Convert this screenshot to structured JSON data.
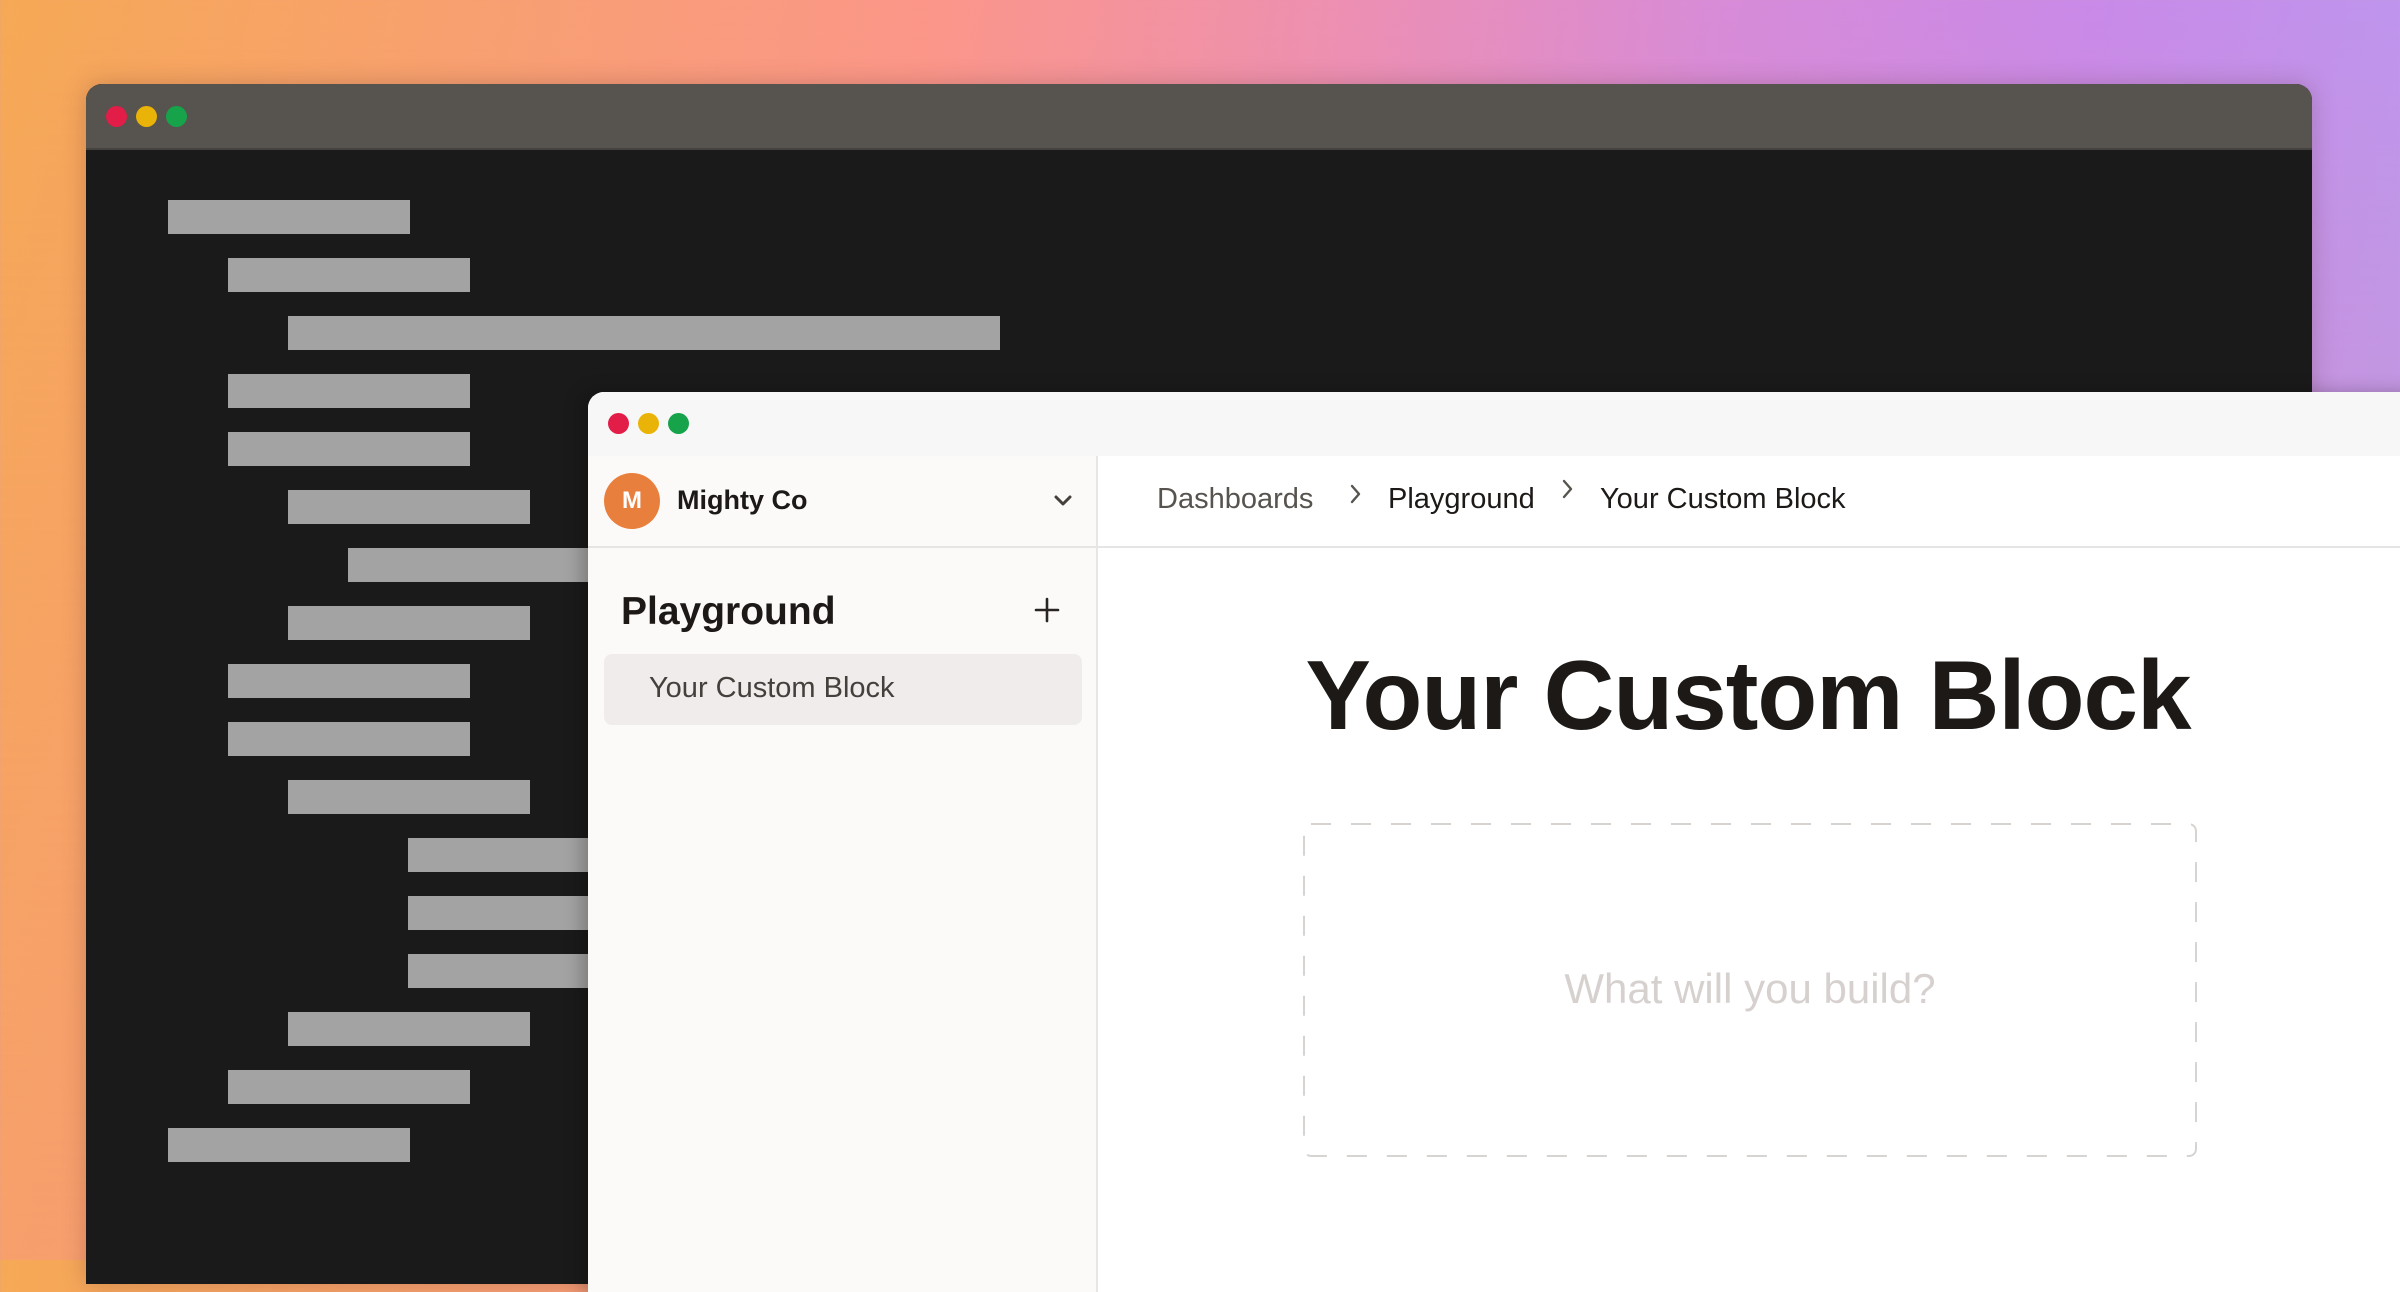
{
  "background": {
    "gradient_colors": [
      "#f6a955",
      "#fb968a",
      "#c98ae8",
      "#b79cf0"
    ]
  },
  "code_window": {
    "traffic_lights": [
      {
        "name": "close",
        "color": "#e11d48"
      },
      {
        "name": "minimize",
        "color": "#eab308"
      },
      {
        "name": "maximize",
        "color": "#16a34a"
      }
    ],
    "titlebar_color": "#57534f",
    "body_color": "#1a1a1a",
    "placeholder_line_color": "#a3a3a3",
    "code_lines": [
      {
        "indent": 0,
        "size": "short"
      },
      {
        "indent": 1,
        "size": "short"
      },
      {
        "indent": 2,
        "size": "long"
      },
      {
        "indent": 1,
        "size": "short"
      },
      {
        "indent": 1,
        "size": "short"
      },
      {
        "indent": 2,
        "size": "short"
      },
      {
        "indent": 3,
        "size": "short"
      },
      {
        "indent": 2,
        "size": "short"
      },
      {
        "indent": 1,
        "size": "short"
      },
      {
        "indent": 1,
        "size": "short"
      },
      {
        "indent": 2,
        "size": "short"
      },
      {
        "indent": 4,
        "size": "short"
      },
      {
        "indent": 4,
        "size": "short"
      },
      {
        "indent": 4,
        "size": "short"
      },
      {
        "indent": 2,
        "size": "short"
      },
      {
        "indent": 1,
        "size": "short"
      },
      {
        "indent": 0,
        "size": "short"
      }
    ]
  },
  "app_window": {
    "traffic_lights": [
      {
        "name": "close",
        "color": "#e11d48"
      },
      {
        "name": "minimize",
        "color": "#eab308"
      },
      {
        "name": "maximize",
        "color": "#16a34a"
      }
    ],
    "workspace": {
      "avatar_letter": "M",
      "avatar_color": "#e97f3c",
      "name": "Mighty Co",
      "switcher_icon": "chevron-down-icon"
    },
    "sidebar": {
      "section_title": "Playground",
      "add_icon": "plus-icon",
      "items": [
        {
          "label": "Your Custom Block",
          "selected": true
        }
      ]
    },
    "breadcrumb": {
      "separator_icon": "chevron-right-icon",
      "items": [
        {
          "label": "Dashboards",
          "current": false
        },
        {
          "label": "Playground",
          "current": false
        },
        {
          "label": "Your Custom Block",
          "current": true
        }
      ]
    },
    "page": {
      "title": "Your Custom Block",
      "placeholder": "What will you build?"
    }
  }
}
